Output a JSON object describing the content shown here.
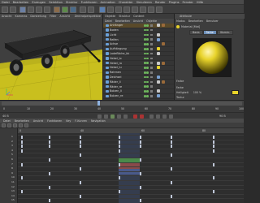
{
  "menubar": {
    "items": [
      "Datei",
      "Bearbeiten",
      "Erzeugen",
      "Selektion",
      "Struktur",
      "Funktionen",
      "Animation",
      "Charakter",
      "Simulieren",
      "Render",
      "Plugins",
      "Fenster",
      "Hilfe"
    ]
  },
  "viewport": {
    "tabs": [
      "Ansicht",
      "Kameras",
      "Darstellung",
      "Filter",
      "Ansicht"
    ],
    "label": "Zentralperspektive",
    "ground_color": "#c9bf1e",
    "bg_color": "#3f3f3f"
  },
  "object_manager": {
    "tabs": [
      "Objekte",
      "Struktur",
      "Content"
    ],
    "menu": [
      "Datei",
      "Bearbeiten",
      "Ansicht",
      "Objekte"
    ],
    "rows": [
      {
        "name": "Anhänger",
        "state": "active"
      },
      {
        "name": "Boden",
        "state": "normal"
      },
      {
        "name": "Licht",
        "state": "normal"
      },
      {
        "name": "Reifen",
        "state": "normal"
      },
      {
        "name": "Achse",
        "state": "normal"
      },
      {
        "name": "Aufhängung",
        "state": "normal"
      },
      {
        "name": "Ladefläche_kk",
        "state": "normal"
      },
      {
        "name": "Hebel_lo",
        "state": "normal"
      },
      {
        "name": "Hebel_ro",
        "state": "normal"
      },
      {
        "name": "Hebel_lu",
        "state": "normal"
      },
      {
        "name": "Rahmen",
        "state": "normal"
      },
      {
        "name": "Deichsel",
        "state": "normal"
      },
      {
        "name": "Räder_li",
        "state": "normal"
      },
      {
        "name": "Räder_re",
        "state": "normal"
      },
      {
        "name": "Bolzen_li",
        "state": "normal"
      },
      {
        "name": "Bolzen_re",
        "state": "normal"
      }
    ]
  },
  "attributes": {
    "title": "Attribute",
    "menu": [
      "Modus",
      "Bearbeiten",
      "Benutzer"
    ],
    "material": "Material [Mat]",
    "tabs": [
      "Basis",
      "Farbe",
      "Illumin."
    ],
    "section": "Farbe",
    "rows": [
      {
        "label": "Farbe",
        "value": ""
      },
      {
        "label": "Helligkeit",
        "value": "100 %"
      },
      {
        "label": "Textur",
        "value": ""
      }
    ],
    "swatch_color": "#e8d32a"
  },
  "timeline": {
    "ticks": [
      "0",
      "10",
      "20",
      "30",
      "40",
      "50",
      "60",
      "70",
      "80",
      "90",
      "100"
    ],
    "current_frame": "40 B",
    "end_frame": "90 B"
  },
  "dopesheet": {
    "menu": [
      "Datei",
      "Bearbeiten",
      "Ansicht",
      "Funktionen",
      "Key",
      "F-Kurven",
      "Navigation"
    ],
    "frame_labels": [
      "0",
      "40",
      "60",
      "80"
    ],
    "track_labels": [
      "1",
      "2",
      "3",
      "4",
      "5",
      "6",
      "7",
      "8",
      "9",
      "10",
      "11",
      "12",
      "13",
      "14",
      "15"
    ]
  }
}
